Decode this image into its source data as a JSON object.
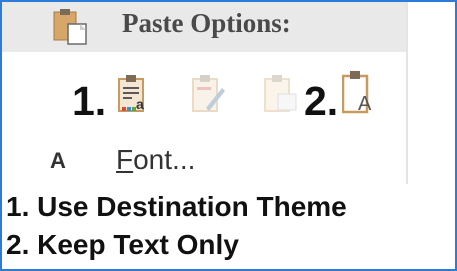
{
  "paste_menu": {
    "header": {
      "label": "Paste Options:",
      "icon": "paste-clipboard-icon"
    },
    "options": [
      {
        "number": "1.",
        "icon": "use-destination-theme-icon",
        "state": "enabled"
      },
      {
        "icon": "keep-source-formatting-icon",
        "state": "disabled"
      },
      {
        "icon": "picture-paste-icon",
        "state": "disabled"
      },
      {
        "number": "2.",
        "icon": "keep-text-only-icon",
        "state": "enabled"
      }
    ],
    "font_item": {
      "icon_letter": "A",
      "label_prefix": "F",
      "label_rest": "ont..."
    }
  },
  "legend": [
    "1. Use Destination Theme",
    "2. Keep Text Only"
  ],
  "colors": {
    "frame_border": "#2e7bd6",
    "header_bg": "#e9e9e9",
    "clipboard_tan": "#d9b07a"
  }
}
